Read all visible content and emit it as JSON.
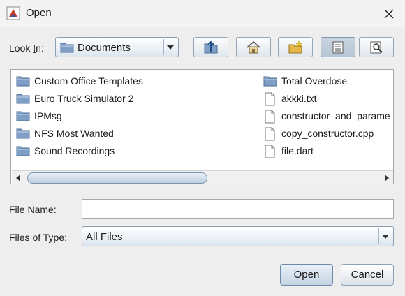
{
  "window": {
    "title": "Open"
  },
  "look_in": {
    "label_pre": "Look ",
    "label_mnemonic": "I",
    "label_post": "n:",
    "value": "Documents"
  },
  "toolbar": {
    "up_icon": "up-one-level-icon",
    "home_icon": "home-icon",
    "new_folder_icon": "new-folder-icon",
    "list_icon": "list-view-icon",
    "details_icon": "details-view-icon"
  },
  "files": {
    "left_column": [
      {
        "name": "Custom Office Templates",
        "type": "folder"
      },
      {
        "name": "Euro Truck Simulator 2",
        "type": "folder"
      },
      {
        "name": "IPMsg",
        "type": "folder"
      },
      {
        "name": "NFS Most Wanted",
        "type": "folder"
      },
      {
        "name": "Sound Recordings",
        "type": "folder"
      }
    ],
    "right_column": [
      {
        "name": "Total Overdose",
        "type": "folder"
      },
      {
        "name": "akkki.txt",
        "type": "file"
      },
      {
        "name": "constructor_and_parame",
        "type": "file"
      },
      {
        "name": "copy_constructor.cpp",
        "type": "file"
      },
      {
        "name": "file.dart",
        "type": "file"
      }
    ]
  },
  "file_name": {
    "label_pre": "File ",
    "label_mnemonic": "N",
    "label_post": "ame:",
    "value": "",
    "placeholder": ""
  },
  "files_of_type": {
    "label_pre": "Files of ",
    "label_mnemonic": "T",
    "label_post": "ype:",
    "value": "All Files"
  },
  "buttons": {
    "open": "Open",
    "cancel": "Cancel"
  },
  "colors": {
    "folder": "#6b8fb8",
    "accent": "#7f93a8"
  }
}
